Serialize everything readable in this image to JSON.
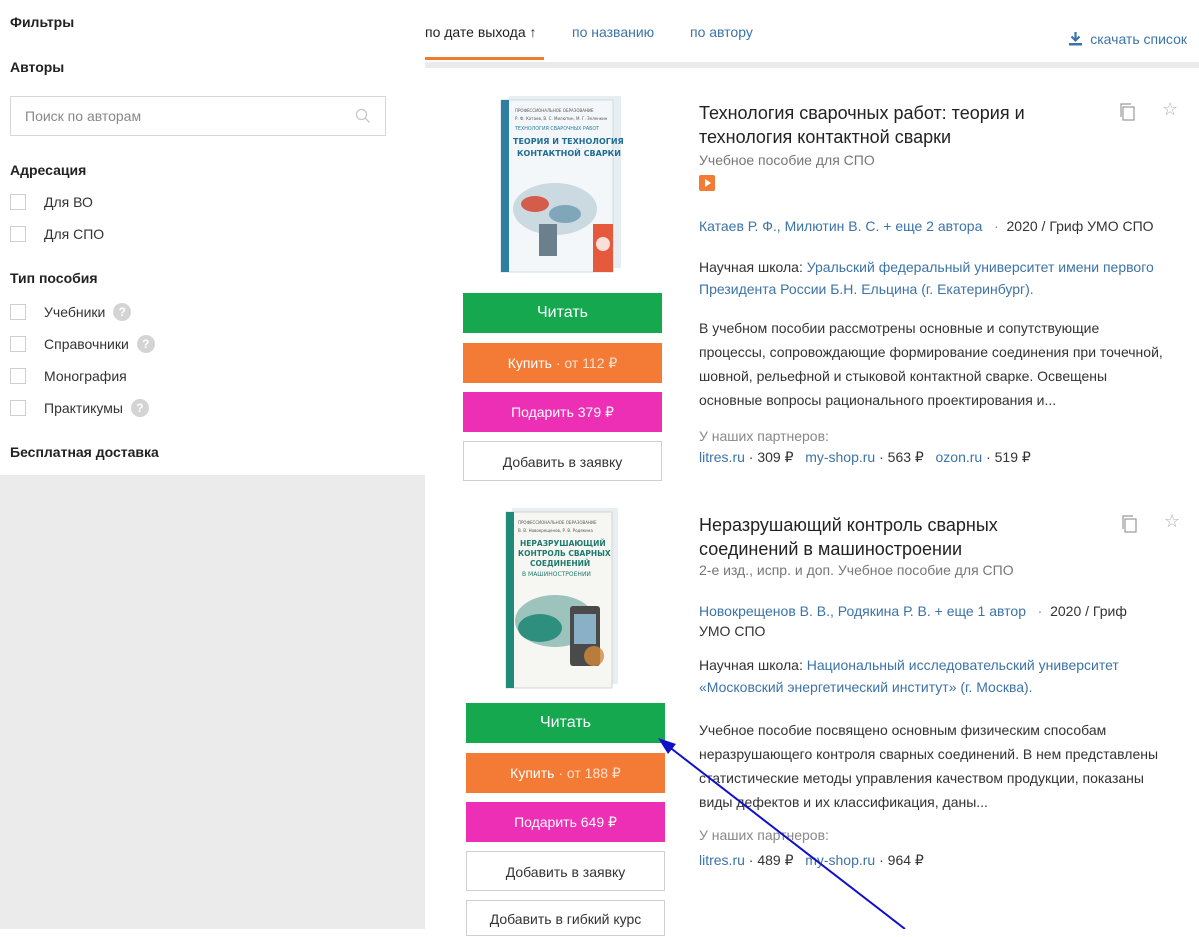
{
  "filters": {
    "title": "Фильтры",
    "authors_heading": "Авторы",
    "author_search_placeholder": "Поиск по авторам",
    "addressing_heading": "Адресация",
    "addressing_options": [
      "Для ВО",
      "Для СПО"
    ],
    "type_heading": "Тип пособия",
    "type_options": [
      "Учебники",
      "Справочники",
      "Монография",
      "Практикумы"
    ],
    "delivery_heading": "Бесплатная доставка"
  },
  "sort": {
    "by_date": "по дате выхода ↑",
    "by_title": "по названию",
    "by_author": "по автору",
    "download": "скачать список"
  },
  "books": [
    {
      "title": "Технология сварочных работ: теория и технология контактной сварки",
      "subtitle": "Учебное пособие для СПО",
      "authors": "Катаев Р. Ф., Милютин В. С.",
      "more_authors": "+ еще 2 автора",
      "year_sep": "·",
      "year": "2020",
      "grif": "/ Гриф УМО СПО",
      "school_label": "Научная школа:",
      "school": "Уральский федеральный университет имени первого Президента России Б.Н. Ельцина (г. Екатеринбург).",
      "description": "В учебном пособии рассмотрены основные и сопутствующие процессы, сопровождающие формирование соединения при точечной, шовной, рельефной и стыковой контактной сварке. Освещены основные вопросы рационального проектирования и...",
      "partners_label": "У наших партнеров:",
      "partners": [
        {
          "name": "litres.ru",
          "price": "· 309 ₽"
        },
        {
          "name": "my-shop.ru",
          "price": "· 563 ₽"
        },
        {
          "name": "ozon.ru",
          "price": "· 519 ₽"
        }
      ],
      "read_label": "Читать",
      "buy_label": "Купить",
      "buy_price": "·  от 112 ₽",
      "gift_label": "Подарить 379 ₽",
      "request_label": "Добавить в заявку"
    },
    {
      "title": "Неразрушающий контроль сварных соединений в машиностроении",
      "subtitle": "2-е изд., испр. и доп. Учебное пособие для СПО",
      "authors": "Новокрещенов В. В., Родякина Р. В.",
      "more_authors": "+ еще 1 автор",
      "year_sep": "·",
      "year": "2020",
      "grif": "/ Гриф",
      "grif2": "УМО СПО",
      "school_label": "Научная школа:",
      "school": "Национальный исследовательский университет «Московский энергетический институт» (г. Москва).",
      "description": "Учебное пособие посвящено основным физическим способам неразрушающего контроля сварных соединений. В нем представлены статистические методы управления качеством продукции, показаны виды дефектов и их классификация, даны...",
      "partners_label": "У наших партнеров:",
      "partners": [
        {
          "name": "litres.ru",
          "price": "· 489 ₽"
        },
        {
          "name": "my-shop.ru",
          "price": "· 964 ₽"
        }
      ],
      "read_label": "Читать",
      "buy_label": "Купить",
      "buy_price": "·  от 188 ₽",
      "gift_label": "Подарить 649 ₽",
      "request_label": "Добавить в заявку",
      "course_label": "Добавить в гибкий курс"
    }
  ],
  "covers": [
    {
      "series": "ПРОФЕССИОНАЛЬНОЕ ОБРАЗОВАНИЕ",
      "authors": "Р. Ф. Катаев, В. С. Милютин, М. Г. Зеленкин",
      "small_title": "ТЕХНОЛОГИЯ СВАРОЧНЫХ РАБОТ",
      "big_title": "ТЕОРИЯ И ТЕХНОЛОГИЯ КОНТАКТНОЙ СВАРКИ"
    },
    {
      "series": "ПРОФЕССИОНАЛЬНОЕ ОБРАЗОВАНИЕ",
      "authors": "В. В. Новокрещенов, Р. В. Родякина",
      "big_title": "НЕРАЗРУШАЮЩИЙ КОНТРОЛЬ СВАРНЫХ СОЕДИНЕНИЙ В МАШИНОСТРОЕНИИ"
    }
  ],
  "colors": {
    "accent_orange": "#f07b2a",
    "read_green": "#15a84f",
    "buy_orange": "#f37b35",
    "gift_pink": "#ec2fb4",
    "link_blue": "#3c73a8",
    "annotation_arrow": "#1010c8"
  },
  "icons": {
    "search": "search-icon",
    "download": "download-icon",
    "copy": "copy-icon",
    "favorite": "star-icon",
    "video": "play-icon",
    "help": "help-icon"
  }
}
